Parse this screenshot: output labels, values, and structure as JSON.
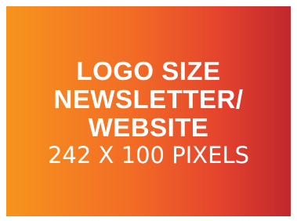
{
  "banner": {
    "line1": "LOGO SIZE",
    "line2": "NEWSLETTER/",
    "line3": "WEBSITE",
    "dimensions": "242 X 100 PIXELS"
  },
  "colors": {
    "gradient_start": "#f7941d",
    "gradient_end": "#c1272d",
    "text": "#ffffff"
  }
}
